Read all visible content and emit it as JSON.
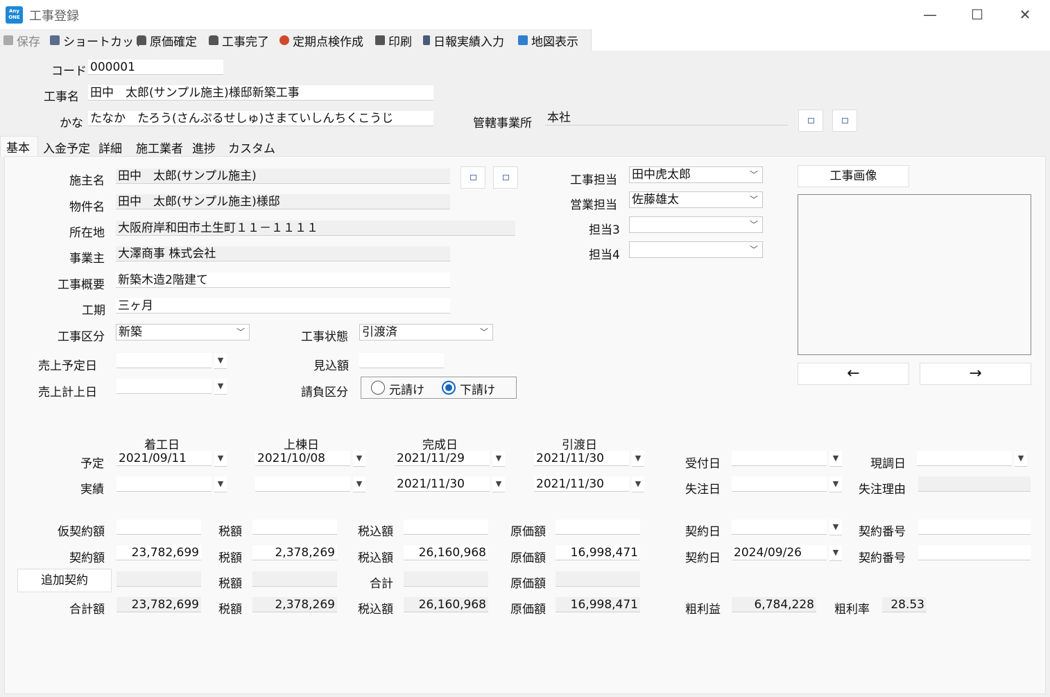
{
  "window": {
    "title": "工事登録",
    "app_icon_text": "Any ONE",
    "min": "—",
    "max": "☐",
    "close": "✕"
  },
  "toolbar": {
    "save": "保存",
    "shortcut": "ショートカット",
    "cost_confirm": "原価確定",
    "work_complete": "工事完了",
    "periodic": "定期点検作成",
    "print": "印刷",
    "daily": "日報実績入力",
    "map": "地図表示"
  },
  "header": {
    "code_label": "コード",
    "code": "000001",
    "name_label": "工事名",
    "name": "田中　太郎(サンプル施主)様邸新築工事",
    "kana_label": "かな",
    "kana": "たなか　たろう(さんぷるせしゅ)さまていしんちくこうじ",
    "office_label": "管轄事業所",
    "office": "本社"
  },
  "tabs": [
    "基本",
    "入金予定",
    "詳細",
    "施工業者",
    "進捗",
    "カスタム"
  ],
  "basic": {
    "owner_label": "施主名",
    "owner": "田中　太郎(サンプル施主)",
    "property_label": "物件名",
    "property": "田中　太郎(サンプル施主)様邸",
    "location_label": "所在地",
    "location": "大阪府岸和田市土生町１１－１１１１",
    "business_label": "事業主",
    "business": "大澤商事 株式会社",
    "summary_label": "工事概要",
    "summary": "新築木造2階建て",
    "period_label": "工期",
    "period": "三ヶ月",
    "category_label": "工事区分",
    "category": "新築",
    "status_label": "工事状態",
    "status": "引渡済",
    "sales_plan_label": "売上予定日",
    "sales_plan": "",
    "sales_actual_label": "売上計上日",
    "sales_actual": "",
    "estimate_label": "見込額",
    "estimate": "",
    "contract_type_label": "請負区分",
    "contract_types": [
      "元請け",
      "下請け"
    ],
    "contract_type_selected": "下請け"
  },
  "staff": {
    "s1_label": "工事担当",
    "s1": "田中虎太郎",
    "s2_label": "営業担当",
    "s2": "佐藤雄太",
    "s3_label": "担当3",
    "s3": "",
    "s4_label": "担当4",
    "s4": ""
  },
  "image": {
    "button": "工事画像",
    "prev": "←",
    "next": "→"
  },
  "schedule": {
    "col_start": "着工日",
    "col_frame": "上棟日",
    "col_done": "完成日",
    "col_handover": "引渡日",
    "row_plan": "予定",
    "row_actual": "実績",
    "plan": [
      "2021/09/11",
      "2021/10/08",
      "2021/11/29",
      "2021/11/30"
    ],
    "actual": [
      "",
      "",
      "2021/11/30",
      "2021/11/30"
    ],
    "reception_label": "受付日",
    "reception": "",
    "survey_label": "現調日",
    "survey": "",
    "lost_label": "失注日",
    "lost": "",
    "lost_reason_label": "失注理由",
    "lost_reason": ""
  },
  "money": {
    "tax": "税額",
    "taxin": "税込額",
    "cost": "原価額",
    "total": "合計",
    "contract_date": "契約日",
    "contract_no": "契約番号",
    "prov_label": "仮契約額",
    "prov": [
      "",
      "",
      "",
      ""
    ],
    "prov_date": "",
    "prov_no": "",
    "contract_label": "契約額",
    "contract": [
      "23,782,699",
      "2,378,269",
      "26,160,968",
      "16,998,471"
    ],
    "contract_d": "2024/09/26",
    "contract_n": "",
    "add_button": "追加契約",
    "add": [
      "",
      "",
      "",
      ""
    ],
    "sum_label": "合計額",
    "sum": [
      "23,782,699",
      "2,378,269",
      "26,160,968",
      "16,998,471"
    ],
    "profit_label": "粗利益",
    "profit": "6,784,228",
    "rate_label": "粗利率",
    "rate": "28.53"
  },
  "colors": {
    "app_icon": "#1e88d6",
    "radio": "#1565c0"
  }
}
